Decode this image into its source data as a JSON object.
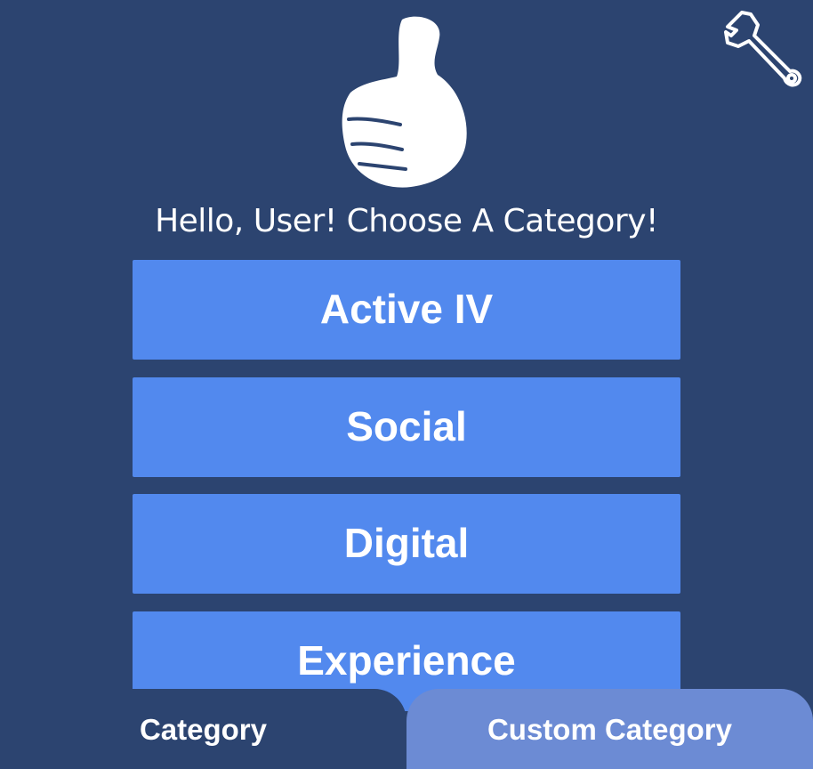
{
  "header": {
    "greeting": "Hello, User! Choose A Category!",
    "logo_icon": "thumbs-up-icon",
    "settings_icon": "wrench-icon"
  },
  "categories": [
    {
      "label": "Active IV"
    },
    {
      "label": "Social"
    },
    {
      "label": "Digital"
    },
    {
      "label": "Experience"
    }
  ],
  "tabs": [
    {
      "label": "Category",
      "selected": true
    },
    {
      "label": "Custom Category",
      "selected": false
    }
  ],
  "colors": {
    "background": "#2c4470",
    "button": "#5289ee",
    "tab_inactive": "#6c8bd4",
    "text": "#ffffff"
  }
}
